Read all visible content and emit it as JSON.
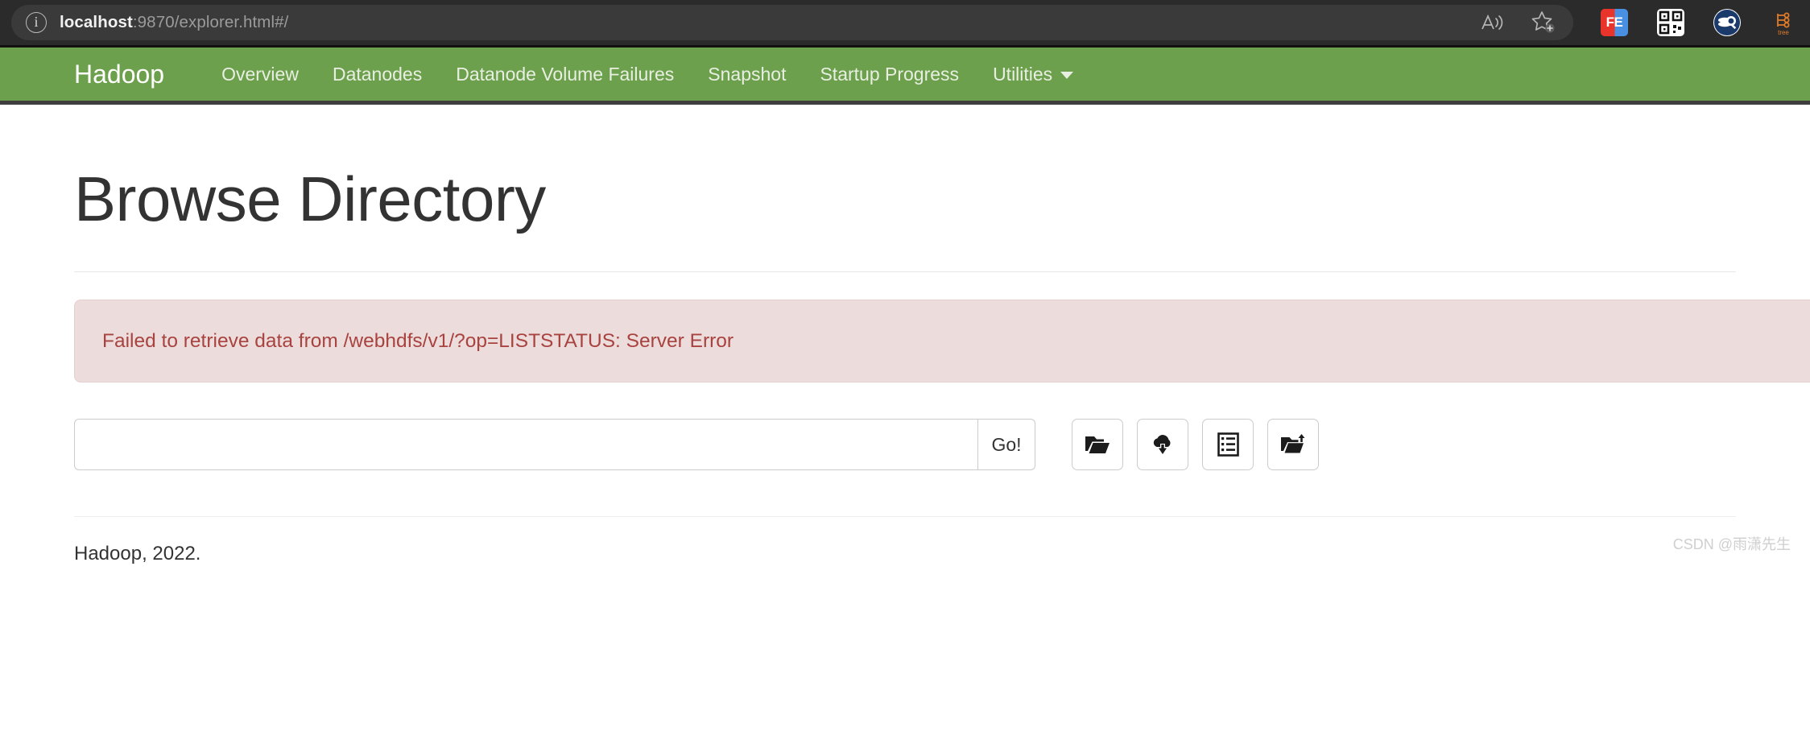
{
  "browser": {
    "url_host": "localhost",
    "url_rest": ":9870/explorer.html#/",
    "info_icon_glyph": "i",
    "actions": [
      {
        "name": "read-aloud-icon",
        "label": "Read aloud"
      },
      {
        "name": "add-favorite-icon",
        "label": "Add this page to favorites"
      }
    ],
    "extensions": [
      {
        "name": "fe-extension-icon",
        "label": "FE"
      },
      {
        "name": "qr-code-icon",
        "label": "QR"
      },
      {
        "name": "circle-badge-icon",
        "label": ""
      },
      {
        "name": "tree-extension-icon",
        "label": "tree"
      }
    ]
  },
  "navbar": {
    "brand": "Hadoop",
    "brand_color": "#ffffff",
    "background_color": "#6da04c",
    "links": [
      {
        "label": "Overview",
        "name": "nav-link-overview"
      },
      {
        "label": "Datanodes",
        "name": "nav-link-datanodes"
      },
      {
        "label": "Datanode Volume Failures",
        "name": "nav-link-datanode-volume-failures"
      },
      {
        "label": "Snapshot",
        "name": "nav-link-snapshot"
      },
      {
        "label": "Startup Progress",
        "name": "nav-link-startup-progress"
      }
    ],
    "dropdown": {
      "label": "Utilities",
      "name": "nav-dropdown-utilities"
    }
  },
  "main": {
    "page_title": "Browse Directory",
    "alert": {
      "message": "Failed to retrieve data from /webhdfs/v1/?op=LISTSTATUS: Server Error",
      "background_color": "#eddcdc",
      "text_color": "#a8433f"
    },
    "path_input": {
      "value": "",
      "placeholder": ""
    },
    "go_button": "Go!",
    "icon_buttons": [
      {
        "name": "open-folder-icon",
        "title": "Browse"
      },
      {
        "name": "cloud-upload-icon",
        "title": "Upload files"
      },
      {
        "name": "list-view-icon",
        "title": "Show snapshots"
      },
      {
        "name": "create-folder-icon",
        "title": "Create directory"
      }
    ]
  },
  "footer": {
    "text": "Hadoop, 2022.",
    "watermark": "CSDN @雨潇先生"
  }
}
